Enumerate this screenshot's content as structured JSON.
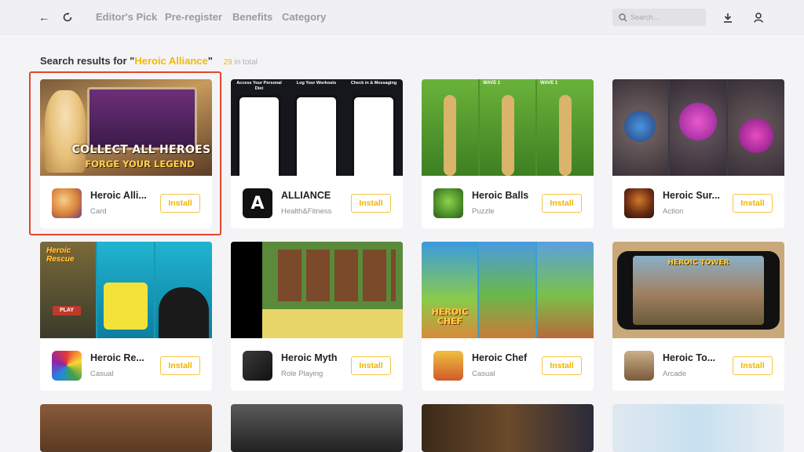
{
  "nav": {
    "links": [
      "Editor's Pick",
      "Pre-register",
      "Benefits",
      "Category"
    ],
    "search_placeholder": "Search..."
  },
  "heading": {
    "prefix": "Search results for \"",
    "query": "Heroic Alliance",
    "suffix": "\"",
    "count": "29",
    "count_suffix": "in total"
  },
  "install_label": "Install",
  "cards": [
    {
      "name": "Heroic Alli...",
      "category": "Card",
      "shot_text_1": "COLLECT ALL HEROES",
      "shot_text_2": "FORGE YOUR LEGEND"
    },
    {
      "name": "ALLIANCE",
      "category": "Health&Fitness",
      "panels": [
        "Access Your Personal Diet",
        "Log Your Workouts",
        "Check in & Messaging"
      ],
      "icon_text": "A"
    },
    {
      "name": "Heroic Balls",
      "category": "Puzzle",
      "wave_1": "WAVE 1",
      "wave_2": "WAVE 1"
    },
    {
      "name": "Heroic Sur...",
      "category": "Action"
    },
    {
      "name": "Heroic Re...",
      "category": "Casual",
      "shot_title": "Heroic Rescue",
      "play": "PLAY"
    },
    {
      "name": "Heroic Myth",
      "category": "Role Playing"
    },
    {
      "name": "Heroic Chef",
      "category": "Casual",
      "shot_title": "HEROIC CHEF"
    },
    {
      "name": "Heroic To...",
      "category": "Arcade",
      "shot_title": "HEROIC TOWER"
    }
  ],
  "colors": {
    "accent": "#f5b800",
    "highlight": "#e2452c"
  }
}
